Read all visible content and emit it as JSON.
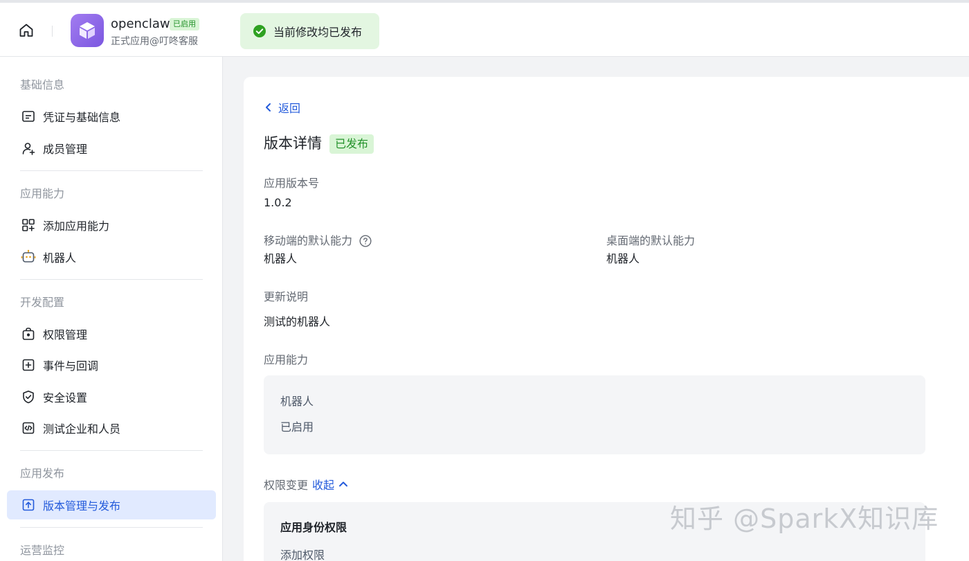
{
  "header": {
    "app_name": "openclaw",
    "app_status": "已启用",
    "app_subtitle": "正式应用@叮咚客服",
    "toast_text": "当前修改均已发布"
  },
  "sidebar": {
    "sections": [
      {
        "title": "基础信息",
        "items": [
          {
            "label": "凭证与基础信息",
            "icon": "credential-icon"
          },
          {
            "label": "成员管理",
            "icon": "add-member-icon"
          }
        ]
      },
      {
        "title": "应用能力",
        "items": [
          {
            "label": "添加应用能力",
            "icon": "add-capability-icon"
          },
          {
            "label": "机器人",
            "icon": "robot-icon"
          }
        ]
      },
      {
        "title": "开发配置",
        "items": [
          {
            "label": "权限管理",
            "icon": "permission-icon"
          },
          {
            "label": "事件与回调",
            "icon": "event-icon"
          },
          {
            "label": "安全设置",
            "icon": "shield-icon"
          },
          {
            "label": "测试企业和人员",
            "icon": "code-icon"
          }
        ]
      },
      {
        "title": "应用发布",
        "items": [
          {
            "label": "版本管理与发布",
            "icon": "upload-icon",
            "active": true
          }
        ]
      },
      {
        "title": "运营监控",
        "items": []
      }
    ]
  },
  "main": {
    "back_label": "返回",
    "title": "版本详情",
    "status_badge": "已发布",
    "version_label": "应用版本号",
    "version_value": "1.0.2",
    "mobile_default_label": "移动端的默认能力",
    "mobile_default_value": "机器人",
    "desktop_default_label": "桌面端的默认能力",
    "desktop_default_value": "机器人",
    "update_notes_label": "更新说明",
    "update_notes_value": "测试的机器人",
    "capabilities_label": "应用能力",
    "capability_name": "机器人",
    "capability_status": "已启用",
    "permission_change_label": "权限变更",
    "collapse_label": "收起",
    "identity_permission_title": "应用身份权限",
    "add_permission_label": "添加权限"
  },
  "watermark": "知乎 @SparkX知识库",
  "colors": {
    "accent": "#245bdb",
    "success_bg": "#d9f5d6",
    "success_text": "#24922b",
    "active_bg": "#e1eaff"
  }
}
